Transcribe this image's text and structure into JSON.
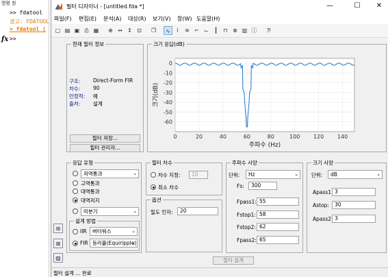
{
  "cmd": {
    "title": "명령 창",
    "lines": [
      ">> fdatool",
      "경고: FDATOOL",
      "> fdatool (",
      ">>"
    ],
    "fx": "fx"
  },
  "window": {
    "title": "필터 디자이너 - [untitled.fda *]",
    "minimize": "—",
    "maximize": "☐",
    "close": "✕"
  },
  "menu": [
    "파일(F)",
    "편집(E)",
    "분석(A)",
    "대상(R)",
    "보기(V)",
    "창(W)",
    "도움말(H)"
  ],
  "current_filter": {
    "title": "현재 필터 정보",
    "rows": [
      {
        "k": "구조:",
        "v": "Direct-Form FIR"
      },
      {
        "k": "차수:",
        "v": "90"
      },
      {
        "k": "안정적:",
        "v": "예"
      },
      {
        "k": "출처:",
        "v": "설계"
      }
    ],
    "store_button": "필터 저장...",
    "manager_button": "필터 관리자..."
  },
  "chart_data": {
    "type": "line",
    "title": "크기 응답(dB)",
    "xlabel": "주파수 (Hz)",
    "ylabel": "크기(dB)",
    "xlim": [
      0,
      150
    ],
    "ylim": [
      -70,
      5
    ],
    "xticks": [
      0,
      20,
      40,
      60,
      80,
      100,
      120,
      140
    ],
    "yticks": [
      0,
      -10,
      -20,
      -30,
      -40,
      -50,
      -60
    ],
    "color": "#2a7fd4",
    "description_points": {
      "passband_ripple_db": 1,
      "notch_center_hz": 60,
      "notch_depth_db": -65
    }
  },
  "response_type": {
    "title": "응답 유형",
    "options": [
      "저역통과",
      "고역통과",
      "대역통과",
      "대역저지",
      "미분기"
    ],
    "selected": "대역저지",
    "design_method_title": "설계 방법",
    "iir_label": "IIR",
    "iir_value": "버터워스",
    "fir_label": "FIR",
    "fir_value": "등리플(Equiripple)"
  },
  "filter_order": {
    "title": "필터 차수",
    "specify_label": "차수 지정:",
    "specify_value": "10",
    "minimum_label": "최소 차수"
  },
  "options": {
    "title": "옵션",
    "density_label": "밀도 인자:",
    "density_value": "20"
  },
  "freq_spec": {
    "title": "주파수 사양",
    "unit_label": "단위:",
    "unit_value": "Hz",
    "fields": [
      {
        "k": "Fs:",
        "v": "300"
      },
      {
        "k": "Fpass1:",
        "v": "55"
      },
      {
        "k": "Fstop1:",
        "v": "58"
      },
      {
        "k": "Fstop2:",
        "v": "62"
      },
      {
        "k": "Fpass2:",
        "v": "65"
      }
    ]
  },
  "mag_spec": {
    "title": "크기 사양",
    "unit_label": "단위:",
    "unit_value": "dB",
    "fields": [
      {
        "k": "Apass1:",
        "v": "3"
      },
      {
        "k": "Astop:",
        "v": "30"
      },
      {
        "k": "Apass2:",
        "v": "3"
      }
    ]
  },
  "design_button": "필터 설계",
  "status": "필터 설계 ... 완료"
}
